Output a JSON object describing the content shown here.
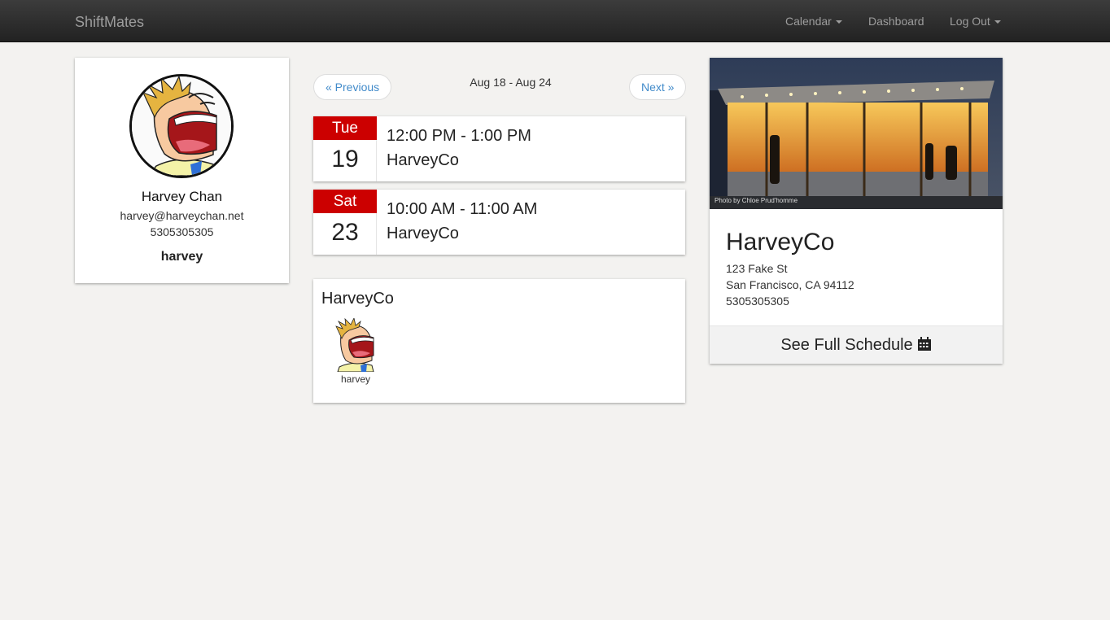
{
  "navbar": {
    "brand": "ShiftMates",
    "items": [
      {
        "label": "Calendar",
        "dropdown": true
      },
      {
        "label": "Dashboard",
        "dropdown": false
      },
      {
        "label": "Log Out",
        "dropdown": true
      }
    ]
  },
  "profile": {
    "name": "Harvey Chan",
    "email": "harvey@harveychan.net",
    "phone": "5305305305",
    "username": "harvey"
  },
  "week_nav": {
    "previous_label": "« Previous",
    "range": "Aug 18 - Aug 24",
    "next_label": "Next »"
  },
  "shifts": [
    {
      "weekday": "Tue",
      "day": "19",
      "time": "12:00 PM - 1:00 PM",
      "company": "HarveyCo"
    },
    {
      "weekday": "Sat",
      "day": "23",
      "time": "10:00 AM - 11:00 AM",
      "company": "HarveyCo"
    }
  ],
  "coworkers": {
    "title": "HarveyCo",
    "members": [
      {
        "username": "harvey"
      }
    ]
  },
  "business": {
    "photo_credit": "Photo by Chloe Prud'homme",
    "name": "HarveyCo",
    "address_line1": "123 Fake St",
    "address_line2": "San Francisco, CA 94112",
    "phone": "5305305305",
    "schedule_link": "See Full Schedule",
    "schedule_icon": "calendar-icon"
  },
  "colors": {
    "navbar": "#222222",
    "link": "#428bca",
    "day_header": "#cc0000",
    "background": "#f3f2f0"
  }
}
